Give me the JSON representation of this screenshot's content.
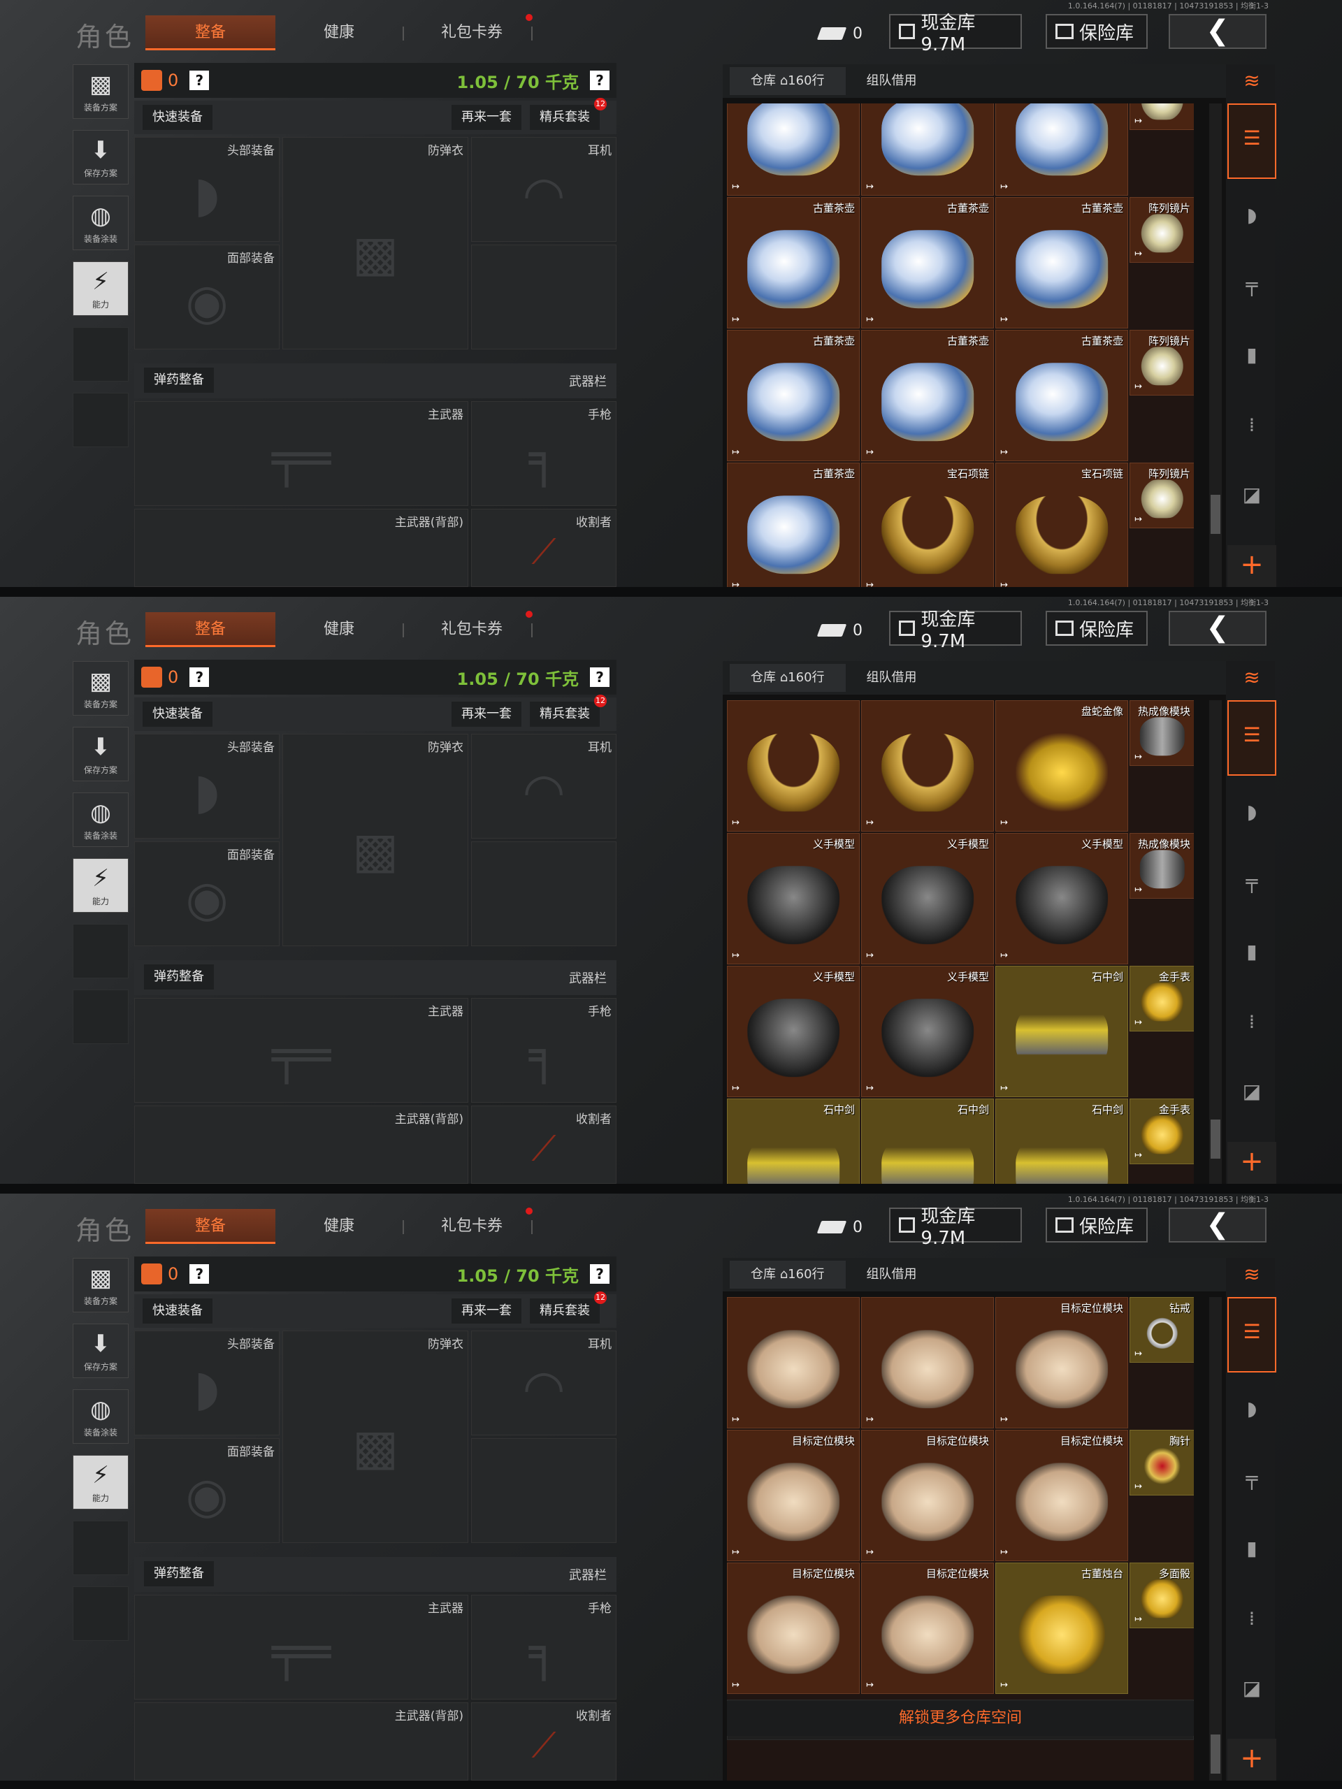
{
  "version": "1.0.164.164(7) | 01181817 | 10473191853 | 均衡1-3",
  "title": "角色",
  "tabs": [
    "整备",
    "健康",
    "礼包卡券"
  ],
  "cash_count": "0",
  "wallet": "现金库 9.7M",
  "vault": "保险库",
  "back": "❮",
  "left_buttons": [
    {
      "icon": "▩",
      "label": "装备方案"
    },
    {
      "icon": "⬇",
      "label": "保存方案"
    },
    {
      "icon": "◍",
      "label": "装备涂装"
    },
    {
      "icon": "⚡",
      "label": "能力"
    }
  ],
  "equip": {
    "bag_count": "0",
    "help": "?",
    "weight": "1.05 / 70 千克",
    "quick": "快速装备",
    "again": "再来一套",
    "elite": "精兵套装",
    "elite_badge": "12",
    "slots": {
      "head": "头部装备",
      "armor": "防弹衣",
      "ear": "耳机",
      "face": "面部装备",
      "main": "主武器",
      "pistol": "手枪",
      "back_main": "主武器(背部)",
      "melee": "收割者"
    },
    "ammo": "弹药整备",
    "weapon_bar": "武器栏"
  },
  "inventory": {
    "tab_store": "仓库",
    "rows": "160行",
    "tab_borrow": "组队借用",
    "unlock": "解锁更多仓库空间",
    "plus": "+"
  },
  "panels": [
    {
      "cells": [
        {
          "c": 0,
          "r": -1,
          "name": "",
          "kind": "pot",
          "g": false
        },
        {
          "c": 1,
          "r": -1,
          "name": "",
          "kind": "pot",
          "g": false
        },
        {
          "c": 2,
          "r": -1,
          "name": "",
          "kind": "pot",
          "g": false
        },
        {
          "c": 3,
          "r": -1,
          "name": "",
          "kind": "lens",
          "g": false
        },
        {
          "c": 0,
          "r": 0,
          "name": "古董茶壶",
          "kind": "pot",
          "g": false
        },
        {
          "c": 1,
          "r": 0,
          "name": "古董茶壶",
          "kind": "pot",
          "g": false
        },
        {
          "c": 2,
          "r": 0,
          "name": "古董茶壶",
          "kind": "pot",
          "g": false
        },
        {
          "c": 3,
          "r": 0,
          "name": "阵列镜片",
          "kind": "lens",
          "g": false
        },
        {
          "c": 0,
          "r": 1,
          "name": "古董茶壶",
          "kind": "pot",
          "g": false
        },
        {
          "c": 1,
          "r": 1,
          "name": "古董茶壶",
          "kind": "pot",
          "g": false
        },
        {
          "c": 2,
          "r": 1,
          "name": "古董茶壶",
          "kind": "pot",
          "g": false
        },
        {
          "c": 3,
          "r": 1,
          "name": "阵列镜片",
          "kind": "lens",
          "g": false
        },
        {
          "c": 0,
          "r": 2,
          "name": "古董茶壶",
          "kind": "pot",
          "g": false
        },
        {
          "c": 1,
          "r": 2,
          "name": "宝石项链",
          "kind": "neck",
          "g": false
        },
        {
          "c": 2,
          "r": 2,
          "name": "宝石项链",
          "kind": "neck",
          "g": false
        },
        {
          "c": 3,
          "r": 2,
          "name": "阵列镜片",
          "kind": "lens",
          "g": false
        },
        {
          "c": 0,
          "r": 3,
          "name": "宝石项链",
          "kind": "neck",
          "g": false
        },
        {
          "c": 1,
          "r": 3,
          "name": "宝石项链",
          "kind": "neck",
          "g": false
        }
      ]
    },
    {
      "cells": [
        {
          "c": 0,
          "r": 0,
          "name": "",
          "kind": "neck",
          "g": false
        },
        {
          "c": 1,
          "r": 0,
          "name": "",
          "kind": "neck",
          "g": false
        },
        {
          "c": 2,
          "r": 0,
          "name": "盘蛇金像",
          "kind": "snake",
          "g": false
        },
        {
          "c": 3,
          "r": 0,
          "name": "热成像模块",
          "kind": "cyl",
          "g": false
        },
        {
          "c": 0,
          "r": 1,
          "name": "义手模型",
          "kind": "hand",
          "g": false
        },
        {
          "c": 1,
          "r": 1,
          "name": "义手模型",
          "kind": "hand",
          "g": false
        },
        {
          "c": 2,
          "r": 1,
          "name": "义手模型",
          "kind": "hand",
          "g": false
        },
        {
          "c": 3,
          "r": 1,
          "name": "热成像模块",
          "kind": "cyl",
          "g": false
        },
        {
          "c": 0,
          "r": 2,
          "name": "义手模型",
          "kind": "hand",
          "g": false
        },
        {
          "c": 1,
          "r": 2,
          "name": "义手模型",
          "kind": "hand",
          "g": false
        },
        {
          "c": 2,
          "r": 2,
          "name": "石中剑",
          "kind": "car",
          "g": true
        },
        {
          "c": 3,
          "r": 2,
          "name": "金手表",
          "kind": "gold",
          "g": true
        },
        {
          "c": 0,
          "r": 3,
          "name": "石中剑",
          "kind": "car",
          "g": true
        },
        {
          "c": 1,
          "r": 3,
          "name": "石中剑",
          "kind": "car",
          "g": true
        },
        {
          "c": 2,
          "r": 3,
          "name": "石中剑",
          "kind": "car",
          "g": true
        },
        {
          "c": 3,
          "r": 3,
          "name": "金手表",
          "kind": "gold",
          "g": true
        }
      ]
    },
    {
      "cells": [
        {
          "c": 0,
          "r": 0,
          "name": "",
          "kind": "box",
          "g": false
        },
        {
          "c": 1,
          "r": 0,
          "name": "",
          "kind": "box",
          "g": false
        },
        {
          "c": 2,
          "r": 0,
          "name": "目标定位模块",
          "kind": "box",
          "g": false
        },
        {
          "c": 3,
          "r": 0,
          "name": "钻戒",
          "kind": "ring",
          "g": true
        },
        {
          "c": 0,
          "r": 1,
          "name": "目标定位模块",
          "kind": "box",
          "g": false
        },
        {
          "c": 1,
          "r": 1,
          "name": "目标定位模块",
          "kind": "box",
          "g": false
        },
        {
          "c": 2,
          "r": 1,
          "name": "目标定位模块",
          "kind": "box",
          "g": false
        },
        {
          "c": 3,
          "r": 1,
          "name": "胸针",
          "kind": "broo",
          "g": true
        },
        {
          "c": 0,
          "r": 2,
          "name": "目标定位模块",
          "kind": "box",
          "g": false
        },
        {
          "c": 1,
          "r": 2,
          "name": "目标定位模块",
          "kind": "box",
          "g": false
        },
        {
          "c": 2,
          "r": 2,
          "name": "古董烛台",
          "kind": "gold",
          "g": true
        },
        {
          "c": 3,
          "r": 2,
          "name": "多面骰",
          "kind": "gold",
          "g": true
        }
      ]
    }
  ]
}
